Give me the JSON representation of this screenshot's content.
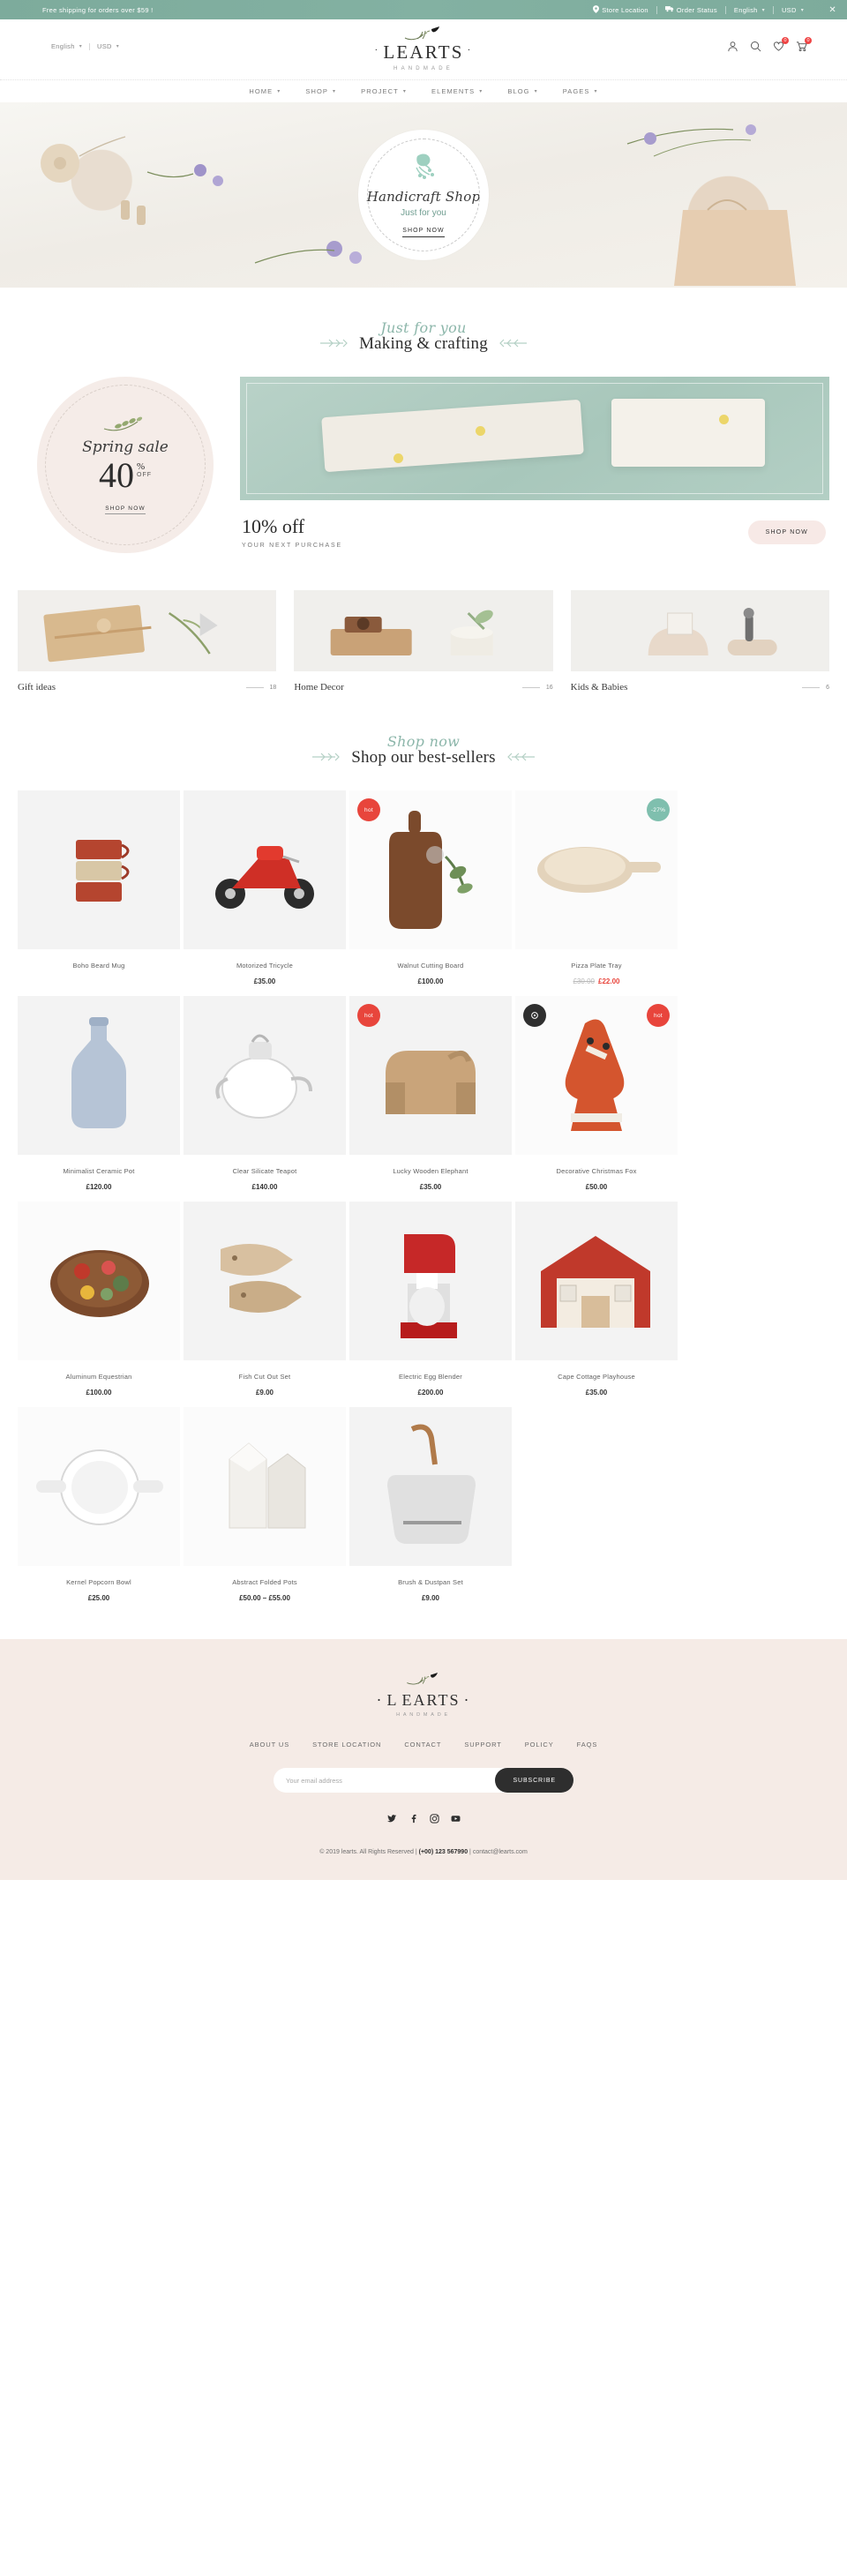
{
  "topbar": {
    "promo": "Free shipping for orders over $59 !",
    "store_location": "Store Location",
    "order_status": "Order Status",
    "language": "English",
    "currency": "USD",
    "close": "✕",
    "bg_color": "#7fae9f",
    "location_icon": "location-pin-icon",
    "truck_icon": "truck-icon"
  },
  "header": {
    "language": "English",
    "currency": "USD",
    "brand": "LEARTS",
    "brand_first": "L",
    "brand_rest": "EARTS",
    "tagline": "HANDMADE",
    "dot_left": "·",
    "dot_right": "·",
    "account_icon": "user-icon",
    "search_icon": "search-icon",
    "wishlist_icon": "heart-icon",
    "cart_icon": "cart-icon",
    "wishlist_count": "0",
    "cart_count": "0",
    "badge_color": "#ef4444"
  },
  "nav": {
    "items": [
      {
        "label": "HOME",
        "has_dropdown": true
      },
      {
        "label": "SHOP",
        "has_dropdown": true
      },
      {
        "label": "PROJECT",
        "has_dropdown": true
      },
      {
        "label": "ELEMENTS",
        "has_dropdown": true
      },
      {
        "label": "BLOG",
        "has_dropdown": true
      },
      {
        "label": "PAGES",
        "has_dropdown": true
      }
    ]
  },
  "hero": {
    "title": "Handicraft Shop",
    "subtitle": "Just for you",
    "button": "SHOP NOW",
    "bird_icon": "bird-branch-icon",
    "accent_color": "#8cc4b4"
  },
  "making_section": {
    "script": "Just for you",
    "title": "Making & crafting",
    "leaf_icon": "leaf-arrow-icon"
  },
  "promo": {
    "spring": {
      "script": "Spring sale",
      "number": "40",
      "percent": "%",
      "off": "OFF",
      "button": "SHOP NOW",
      "bg_color": "#f5ece8",
      "sprig_icon": "olive-branch-icon"
    },
    "offer": {
      "title": "10% off",
      "subtitle": "YOUR NEXT PURCHASE",
      "button": "SHOP NOW",
      "button_color": "#f7e9e6",
      "image_color": "#b0cdc1"
    }
  },
  "categories": [
    {
      "name": "Gift ideas",
      "count": "18"
    },
    {
      "name": "Home Decor",
      "count": "16"
    },
    {
      "name": "Kids & Babies",
      "count": "6"
    }
  ],
  "bestsellers_section": {
    "script": "Shop now",
    "title": "Shop our best-sellers",
    "leaf_icon": "leaf-arrow-icon"
  },
  "products": [
    {
      "name": "Boho Beard Mug",
      "price": "",
      "old_price": "",
      "new_price": "",
      "tag": "",
      "tag_type": ""
    },
    {
      "name": "Motorized Tricycle",
      "price": "£35.00",
      "old_price": "",
      "new_price": "",
      "tag": "",
      "tag_type": ""
    },
    {
      "name": "Walnut Cutting Board",
      "price": "£100.00",
      "old_price": "",
      "new_price": "",
      "tag": "hot",
      "tag_type": "hot"
    },
    {
      "name": "Pizza Plate Tray",
      "price": "",
      "old_price": "£30.00",
      "new_price": "£22.00",
      "tag": "-27%",
      "tag_type": "sale"
    },
    {
      "name": "Minimalist Ceramic Pot",
      "price": "£120.00",
      "old_price": "",
      "new_price": "",
      "tag": "",
      "tag_type": ""
    },
    {
      "name": "Clear Silicate Teapot",
      "price": "£140.00",
      "old_price": "",
      "new_price": "",
      "tag": "",
      "tag_type": ""
    },
    {
      "name": "Lucky Wooden Elephant",
      "price": "£35.00",
      "old_price": "",
      "new_price": "",
      "tag": "hot",
      "tag_type": "hot"
    },
    {
      "name": "Decorative Christmas Fox",
      "price": "£50.00",
      "old_price": "",
      "new_price": "",
      "tag": "hot",
      "tag_type": "hot-dark"
    },
    {
      "name": "Aluminum Equestrian",
      "price": "£100.00",
      "old_price": "",
      "new_price": "",
      "tag": "",
      "tag_type": ""
    },
    {
      "name": "Fish Cut Out Set",
      "price": "£9.00",
      "old_price": "",
      "new_price": "",
      "tag": "",
      "tag_type": ""
    },
    {
      "name": "Electric Egg Blender",
      "price": "£200.00",
      "old_price": "",
      "new_price": "",
      "tag": "",
      "tag_type": ""
    },
    {
      "name": "Cape Cottage Playhouse",
      "price": "£35.00",
      "old_price": "",
      "new_price": "",
      "tag": "",
      "tag_type": ""
    },
    {
      "name": "Kernel Popcorn Bowl",
      "price": "£25.00",
      "old_price": "",
      "new_price": "",
      "tag": "",
      "tag_type": ""
    },
    {
      "name": "Abstract Folded Pots",
      "price": "£50.00 – £55.00",
      "old_price": "",
      "new_price": "",
      "tag": "",
      "tag_type": ""
    },
    {
      "name": "Brush & Dustpan Set",
      "price": "£9.00",
      "old_price": "",
      "new_price": "",
      "tag": "",
      "tag_type": ""
    }
  ],
  "footer": {
    "brand_first": "L",
    "brand_rest": "EARTS",
    "tagline": "HANDMADE",
    "dot_left": "·",
    "dot_right": "·",
    "links": [
      "ABOUT US",
      "STORE LOCATION",
      "CONTACT",
      "SUPPORT",
      "POLICY",
      "FAQS"
    ],
    "email_placeholder": "Your email address",
    "email_value": "",
    "subscribe_label": "SUBSCRIBE",
    "social": [
      "twitter-icon",
      "facebook-icon",
      "instagram-icon",
      "youtube-icon"
    ],
    "copyright_prefix": "© 2019 learts. All Rights Reserved | ",
    "phone": "(+00) 123 567990",
    "copyright_sep": " | ",
    "email": "contact@learts.com",
    "bg_color": "#f5ebe6"
  }
}
